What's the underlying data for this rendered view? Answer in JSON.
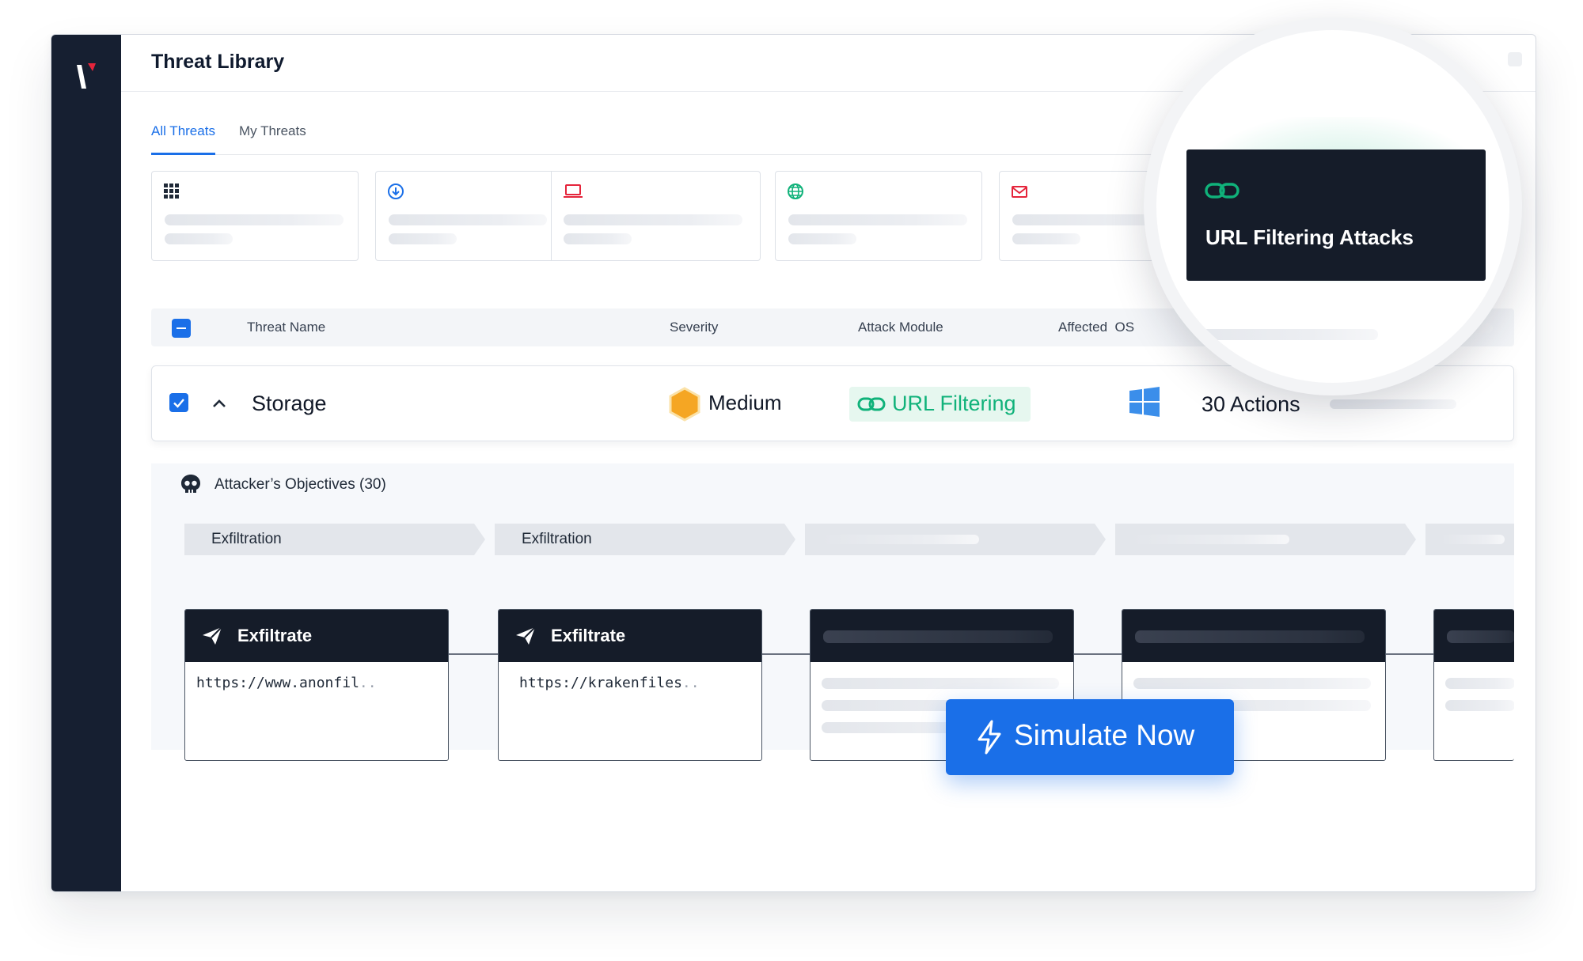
{
  "header": {
    "title": "Threat Library"
  },
  "tabs": [
    {
      "label": "All Threats",
      "active": true
    },
    {
      "label": "My Threats",
      "active": false
    }
  ],
  "category_icons": [
    "grid-icon",
    "download-icon",
    "laptop-icon",
    "globe-icon",
    "mail-icon"
  ],
  "table": {
    "columns": {
      "threat_name": "Threat Name",
      "severity": "Severity",
      "attack_module": "Attack Module",
      "affected_os": "Affected  OS"
    },
    "row": {
      "name": "Storage",
      "severity": "Medium",
      "attack_module": "URL Filtering",
      "os_icon": "windows-icon",
      "actions": "30 Actions"
    }
  },
  "objectives": {
    "title": "Attacker’s Objectives (30)",
    "stages": [
      "Exfiltration",
      "Exfiltration"
    ],
    "nodes": [
      {
        "title": "Exfiltrate",
        "url_prefix": "https://",
        "url_rest": "www.anonfil",
        "url_fade": ".."
      },
      {
        "title": "Exfiltrate",
        "url_prefix": "https://",
        "url_rest": "krakenfiles",
        "url_fade": ".."
      }
    ]
  },
  "simulate_button": {
    "label": "Simulate Now"
  },
  "tooltip": {
    "title": "URL Filtering Attacks"
  },
  "colors": {
    "sidebar": "#161f31",
    "primary": "#1a6fe8",
    "accent_green": "#10b27a",
    "severity_medium": "#f5a623",
    "logo_red": "#e5243b",
    "dark_card": "#151c29"
  }
}
